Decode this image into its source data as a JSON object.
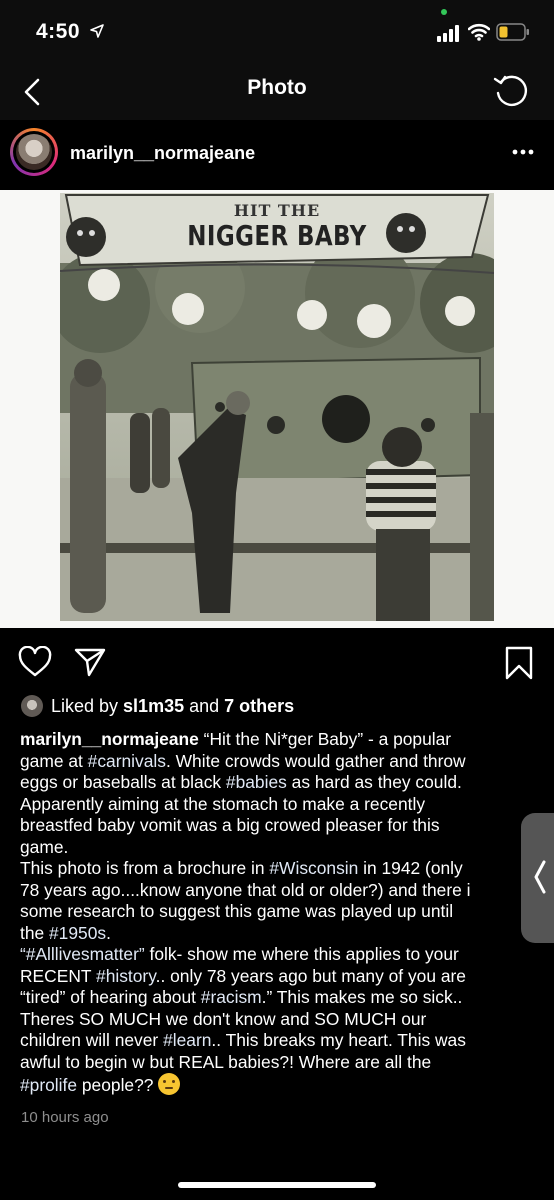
{
  "status_bar": {
    "time": "4:50",
    "icons": [
      "location-arrow-icon",
      "cellular-signal-icon",
      "wifi-icon",
      "battery-icon"
    ],
    "battery_color": "#f2c230"
  },
  "nav": {
    "title": "Photo",
    "back_icon": "chevron-left-icon",
    "refresh_icon": "refresh-icon"
  },
  "post": {
    "username": "marilyn__normajeane",
    "more_icon": "more-dots-icon",
    "photo": {
      "sign_line_1": "HIT THE",
      "sign_line_2": "NIGGER BABY"
    },
    "actions": {
      "like_icon": "heart-icon",
      "share_icon": "paper-plane-icon",
      "save_icon": "bookmark-icon"
    },
    "likes": {
      "prefix": "Liked by ",
      "user": "sl1m35",
      "middle": " and ",
      "others": "7 others"
    },
    "caption": {
      "line_1_user": "marilyn__normajeane",
      "line_1_rest": " “Hit the Ni*ger Baby” - a popular",
      "line_2_a": "game at ",
      "line_2_tag": "#carnivals",
      "line_2_b": ". White crowds would gather and throw",
      "line_3_a": "eggs or baseballs at black ",
      "line_3_tag": "#babies",
      "line_3_b": " as hard as they could.",
      "line_4": "Apparently aiming at the stomach to make a recently",
      "line_5": "breastfed baby vomit was a big crowed pleaser for this",
      "line_6": "game.",
      "line_7_a": "This photo is from a brochure in ",
      "line_7_tag": "#Wisconsin",
      "line_7_b": " in 1942 (only",
      "line_8": "78 years ago....know anyone that old or older?) and there i",
      "line_9": "some research to suggest this game was played up until",
      "line_10_a": "the ",
      "line_10_tag": "#1950s",
      "line_10_b": ".",
      "line_11_tag": "“#Alllivesmatter”",
      "line_11_b": " folk- show me where this applies to your",
      "line_12_a": "RECENT ",
      "line_12_tag": "#history",
      "line_12_b": ".. only 78 years ago but many of you are",
      "line_13_a": "“tired” of hearing about ",
      "line_13_tag": "#racism",
      "line_13_b": ".” This makes me so sick..",
      "line_14": "Theres SO MUCH we don't know and SO MUCH our",
      "line_15_a": "children will never ",
      "line_15_tag": "#learn",
      "line_15_b": ".. This breaks my heart. This was",
      "line_16": "awful to begin w but REAL babies?! Where are all the",
      "line_17_tag": "#prolife",
      "line_17_b": " people?? ",
      "emoji": "thinking-face-emoji"
    },
    "timestamp": "10 hours ago"
  },
  "side_handle": {
    "icon": "chevron-left-icon"
  }
}
